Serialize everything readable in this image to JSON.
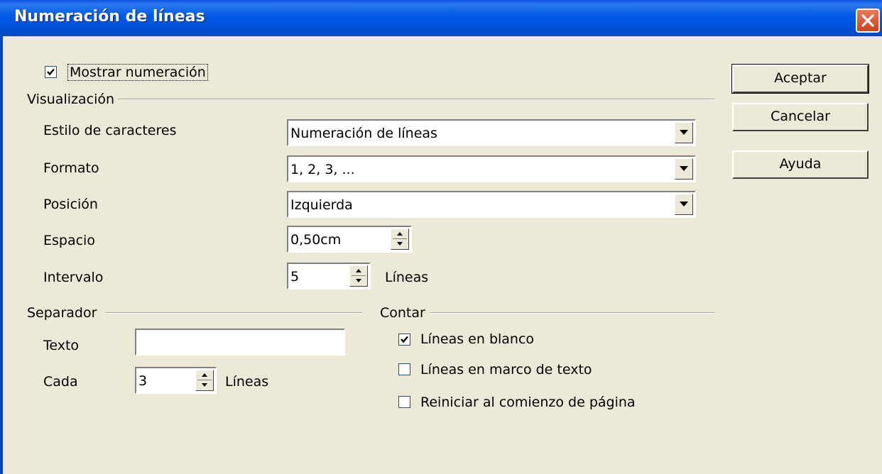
{
  "window": {
    "title": "Numeración de líneas"
  },
  "show_numbering": {
    "label": "Mostrar numeración",
    "checked": true
  },
  "visualization": {
    "group_label": "Visualización",
    "char_style": {
      "label": "Estilo de caracteres",
      "value": "Numeración de líneas"
    },
    "format": {
      "label": "Formato",
      "value": "1, 2, 3, ..."
    },
    "position": {
      "label": "Posición",
      "value": "Izquierda"
    },
    "spacing": {
      "label": "Espacio",
      "value": "0,50cm"
    },
    "interval": {
      "label": "Intervalo",
      "value": "5",
      "unit": "Líneas"
    }
  },
  "separator": {
    "group_label": "Separador",
    "text": {
      "label": "Texto",
      "value": ""
    },
    "every": {
      "label": "Cada",
      "value": "3",
      "unit": "Líneas"
    }
  },
  "count": {
    "group_label": "Contar",
    "blank_lines": {
      "label": "Líneas en blanco",
      "checked": true
    },
    "text_frame_lines": {
      "label": "Líneas en marco de texto",
      "checked": false
    },
    "restart_each_page": {
      "label": "Reiniciar al comienzo de página",
      "checked": false
    }
  },
  "buttons": {
    "ok": "Aceptar",
    "cancel": "Cancelar",
    "help": "Ayuda"
  }
}
